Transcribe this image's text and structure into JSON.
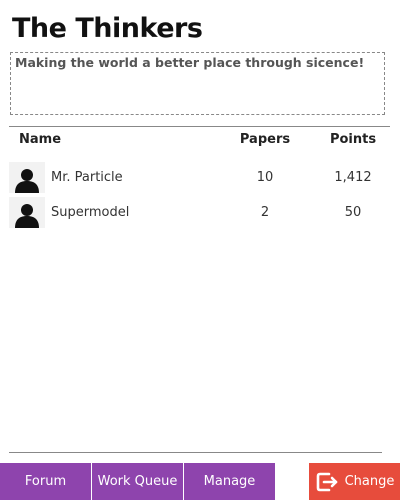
{
  "team": {
    "name": "The Thinkers",
    "motto": "Making the world a better place through sicence!"
  },
  "table": {
    "headers": {
      "name": "Name",
      "papers": "Papers",
      "points": "Points"
    },
    "rows": [
      {
        "name": "Mr. Particle",
        "papers": "10",
        "points": "1,412",
        "avatar_icon": "user-silhouette-icon"
      },
      {
        "name": "Supermodel",
        "papers": "2",
        "points": "50",
        "avatar_icon": "user-silhouette-icon"
      }
    ]
  },
  "nav": {
    "forum_label": "Forum",
    "work_queue_label": "Work Queue",
    "manage_label": "Manage",
    "change_label": "Change",
    "change_icon": "exit-arrow-icon"
  },
  "colors": {
    "nav_purple": "#8e44ad",
    "change_red": "#e74c3c"
  }
}
